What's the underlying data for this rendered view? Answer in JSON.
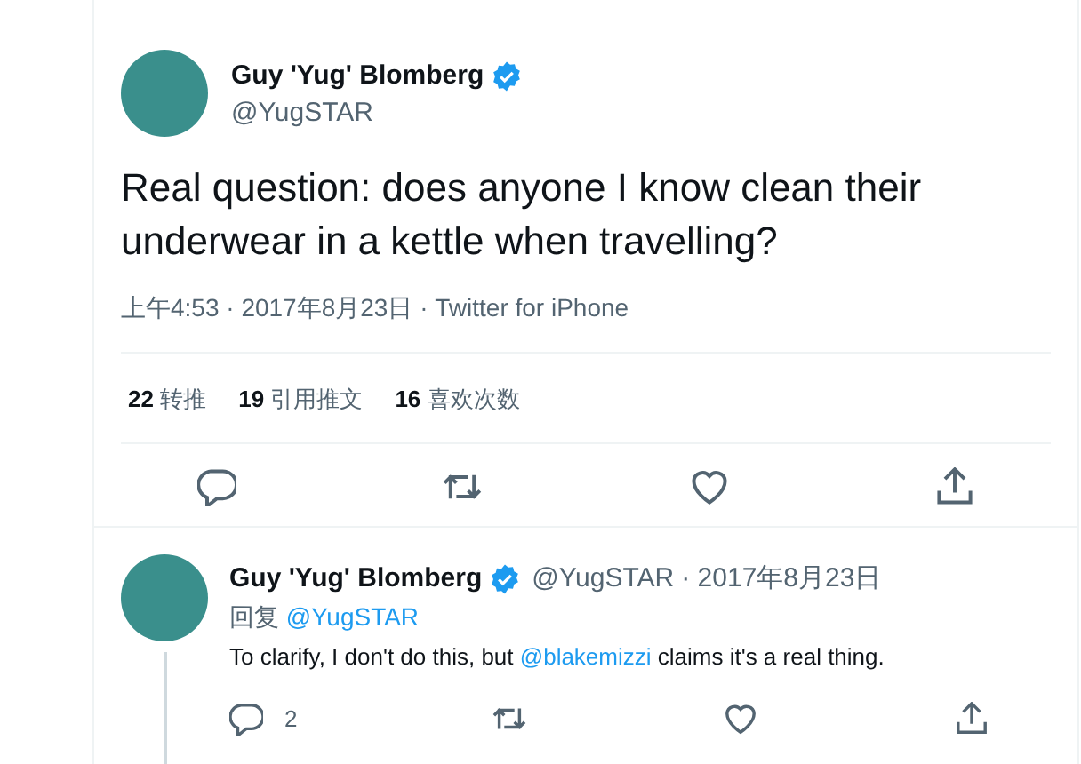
{
  "tweet": {
    "author": {
      "name": "Guy 'Yug' Blomberg",
      "verified": true,
      "handle": "@YugSTAR"
    },
    "text": "Real question: does anyone I know clean their underwear in a kettle when travelling?",
    "meta": "上午4:53 · 2017年8月23日 · Twitter for iPhone",
    "stats": [
      {
        "text": "**22** 转推"
      },
      {
        "text": "**19** 引用推文"
      },
      {
        "text": "**16** 喜欢次数"
      }
    ],
    "actions": [
      {
        "kind": "reply"
      },
      {
        "kind": "retweet"
      },
      {
        "kind": "like"
      },
      {
        "kind": "share"
      }
    ]
  },
  "reply": {
    "author": {
      "name": "Guy 'Yug' Blomberg",
      "verified": true,
      "handle": "@YugSTAR"
    },
    "date": "· 2017年8月23日",
    "replying_to": [
      {
        "kind": "text",
        "text": "回复 "
      },
      {
        "kind": "mention",
        "text": "@YugSTAR"
      }
    ],
    "text": [
      {
        "kind": "text",
        "text": "To clarify, I don't do this, but "
      },
      {
        "kind": "mention",
        "text": "@blakemizzi"
      },
      {
        "kind": "text",
        "text": " claims it's a real thing."
      }
    ],
    "actions": [
      {
        "kind": "reply",
        "count": "2"
      },
      {
        "kind": "retweet"
      },
      {
        "kind": "like"
      },
      {
        "kind": "share"
      }
    ]
  }
}
